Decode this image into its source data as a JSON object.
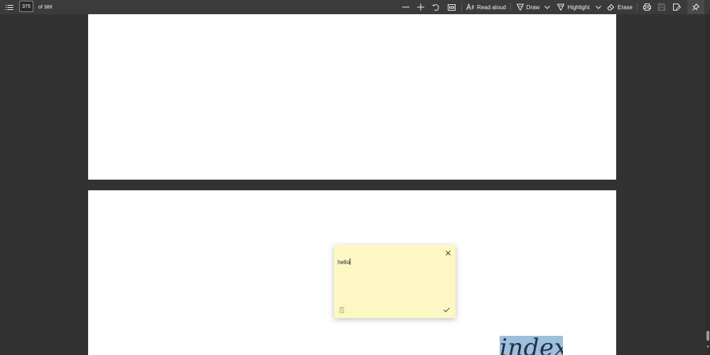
{
  "toolbar": {
    "page_number": "375",
    "page_total": "of 386",
    "read_aloud_label": "Read aloud",
    "draw_label": "Draw",
    "highlight_label": "Highlight",
    "erase_label": "Erase",
    "icons": {
      "contents": "list-icon",
      "zoom_out": "minus-icon",
      "zoom_in": "plus-icon",
      "rotate": "rotate-icon",
      "fit": "fit-page-icon",
      "read_aloud": "read-aloud-icon",
      "draw": "draw-pen-icon",
      "highlight": "highlighter-icon",
      "erase": "eraser-icon",
      "print": "printer-icon",
      "save": "save-icon",
      "save_as": "save-as-icon",
      "pin": "pin-icon"
    }
  },
  "sticky_note": {
    "text": "hello",
    "background": "#fdf7c3"
  },
  "document": {
    "highlighted_word": "index",
    "highlight_color": "#9cbfdc"
  },
  "colors": {
    "app_background": "#323232",
    "toolbar_background": "#3b3b3b",
    "page_background": "#ffffff"
  }
}
